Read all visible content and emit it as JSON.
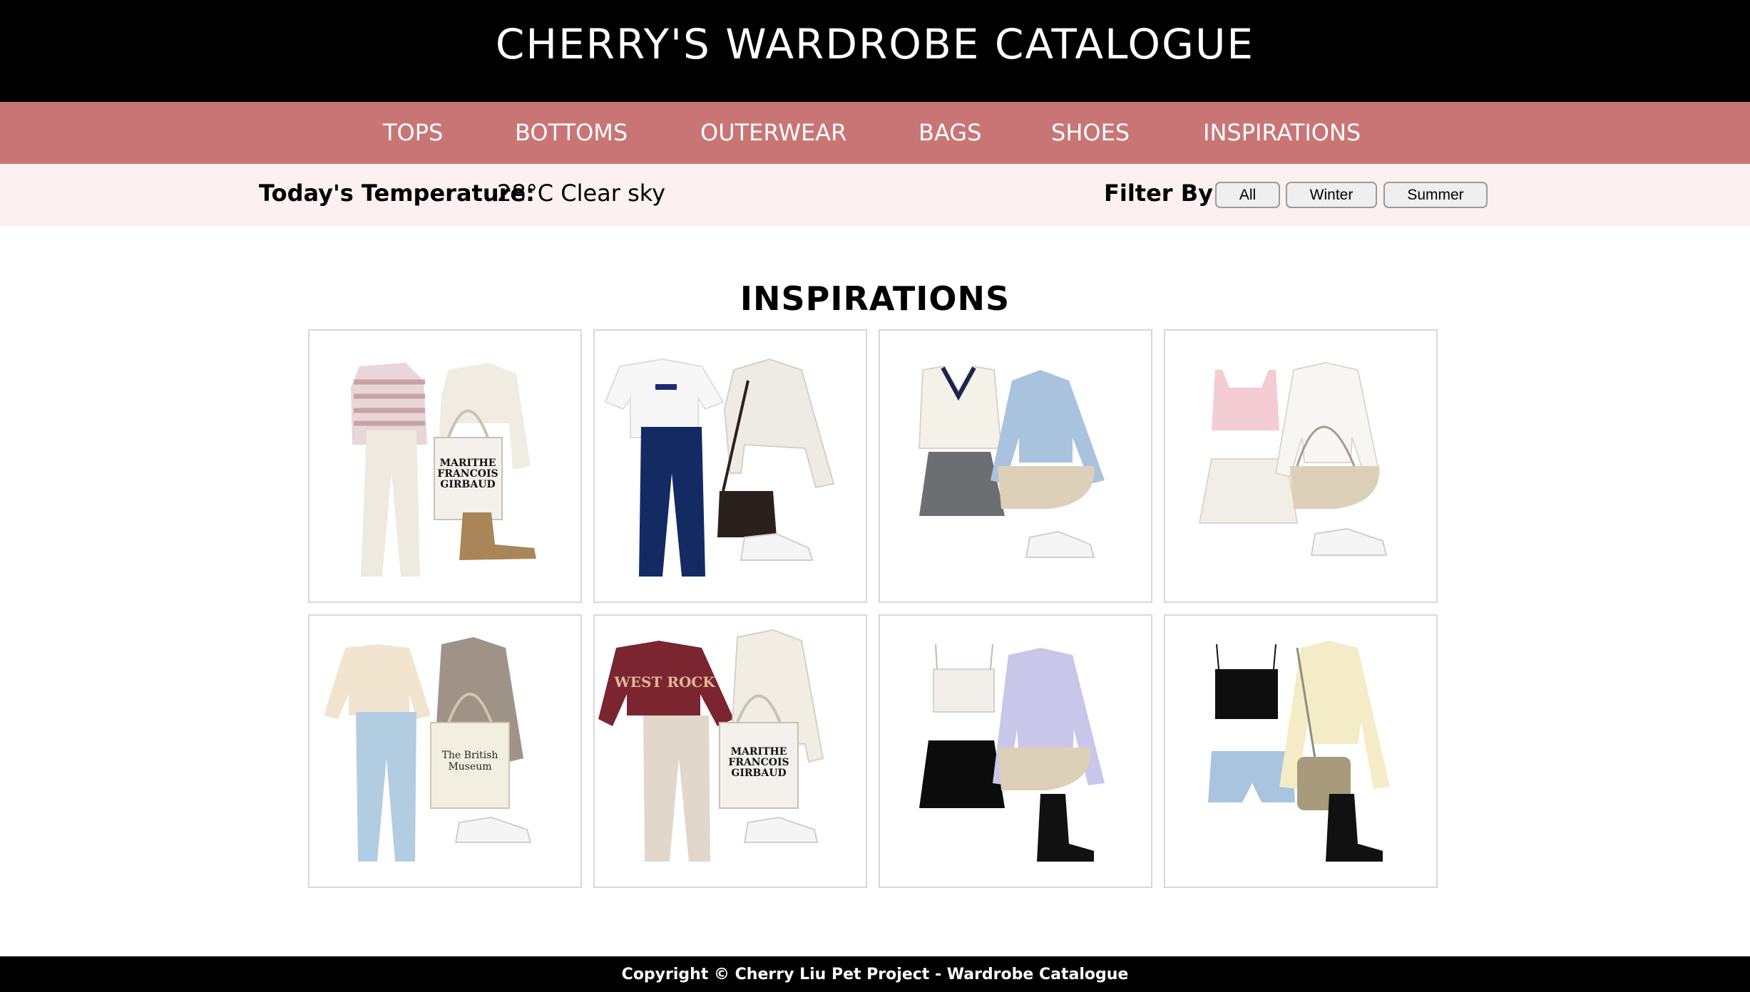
{
  "header": {
    "title": "CHERRY'S WARDROBE CATALOGUE"
  },
  "nav": {
    "items": [
      {
        "label": "TOPS"
      },
      {
        "label": "BOTTOMS"
      },
      {
        "label": "OUTERWEAR"
      },
      {
        "label": "BAGS"
      },
      {
        "label": "SHOES"
      },
      {
        "label": "INSPIRATIONS"
      }
    ]
  },
  "weather": {
    "label": "Today's Temperature:",
    "value": "28°C Clear sky"
  },
  "filter": {
    "label": "Filter By:",
    "buttons": [
      "All",
      "Winter",
      "Summer"
    ]
  },
  "main": {
    "title": "INSPIRATIONS"
  },
  "outfits": [
    {
      "bag_text": "MARITHE FRANCOIS GIRBAUD"
    },
    {
      "logo_text": ""
    },
    {
      "logo_text": ""
    },
    {
      "logo_text": ""
    },
    {
      "bag_text": "The British Museum"
    },
    {
      "sweater_text": "WEST ROCK",
      "bag_text": "MARITHE FRANCOIS GIRBAUD"
    },
    {
      "logo_text": ""
    },
    {
      "logo_text": ""
    }
  ],
  "footer": {
    "text": "Copyright © Cherry Liu Pet Project - Wardrobe Catalogue"
  },
  "colors": {
    "header_bg": "#000000",
    "nav_bg": "#c97576",
    "infobar_bg": "#fdf0f0",
    "footer_bg": "#000000"
  }
}
